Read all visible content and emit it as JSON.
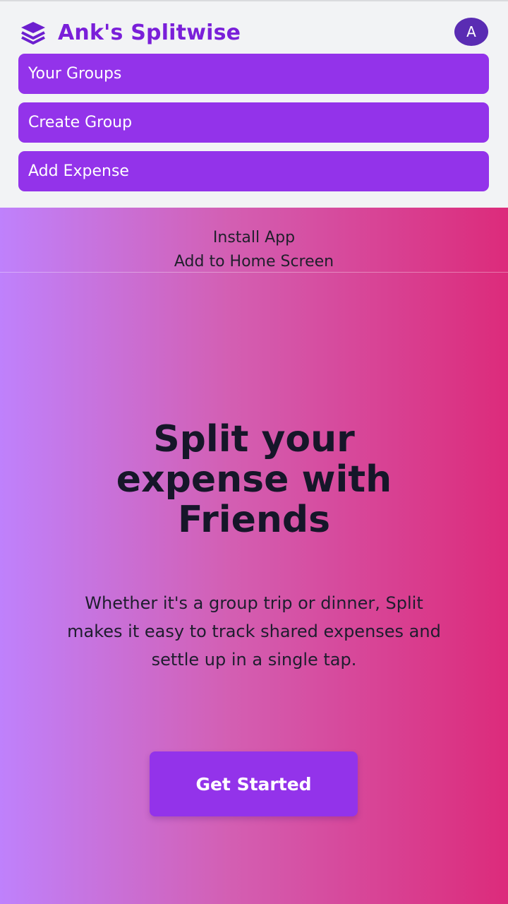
{
  "header": {
    "brand_icon": "layers-icon",
    "brand_title": "Ank's Splitwise",
    "avatar_initial": "A",
    "nav": [
      {
        "label": "Your Groups"
      },
      {
        "label": "Create Group"
      },
      {
        "label": "Add Expense"
      }
    ]
  },
  "install": {
    "title": "Install App",
    "subtitle": "Add to Home Screen"
  },
  "hero": {
    "title_lines": [
      "Split your",
      "expense with",
      "Friends"
    ],
    "description": "Whether it's a group trip or dinner, Split makes it easy to track shared expenses and settle up in a single tap.",
    "cta_label": "Get Started"
  },
  "colors": {
    "brand": "#7a1fd9",
    "button": "#9333ea",
    "avatar": "#5a2cb3",
    "gradient_left": "#bf81fc",
    "gradient_right": "#dc2b7b"
  }
}
